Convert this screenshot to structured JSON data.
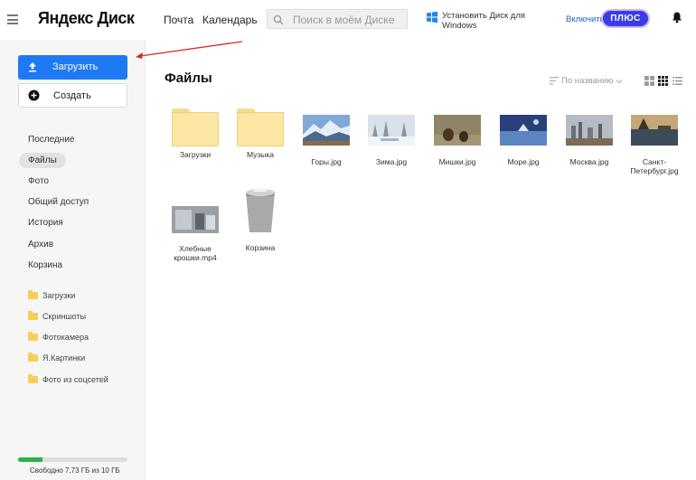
{
  "header": {
    "logo": "Яндекс Диск",
    "nav_mail": "Почта",
    "nav_calendar": "Календарь",
    "search_placeholder": "Поиск в моём Диске",
    "install_text": "Установить Диск для Windows",
    "plus_prefix": "Включить",
    "plus_label": "ПЛЮС"
  },
  "sidebar": {
    "upload_label": "Загрузить",
    "create_label": "Создать",
    "nav": [
      {
        "label": "Последние",
        "active": false
      },
      {
        "label": "Файлы",
        "active": true
      },
      {
        "label": "Фото",
        "active": false
      },
      {
        "label": "Общий доступ",
        "active": false
      },
      {
        "label": "История",
        "active": false
      },
      {
        "label": "Архив",
        "active": false
      },
      {
        "label": "Корзина",
        "active": false
      }
    ],
    "folders": [
      {
        "label": "Загрузки"
      },
      {
        "label": "Скриншоты"
      },
      {
        "label": "Фотокамера"
      },
      {
        "label": "Я.Картинки"
      },
      {
        "label": "Фото из соцсетей"
      }
    ],
    "storage": {
      "text": "Свободно 7,73 ГБ из 10 ГБ",
      "used_fraction": 0.227
    }
  },
  "main": {
    "title": "Файлы",
    "sort_label": "По названию",
    "files": [
      {
        "name": "Загрузки",
        "kind": "folder"
      },
      {
        "name": "Музыка",
        "kind": "folder"
      },
      {
        "name": "Горы.jpg",
        "kind": "image",
        "thumb": "mountains"
      },
      {
        "name": "Зима.jpg",
        "kind": "image",
        "thumb": "winter"
      },
      {
        "name": "Мишки.jpg",
        "kind": "image",
        "thumb": "bears"
      },
      {
        "name": "Море.jpg",
        "kind": "image",
        "thumb": "sea"
      },
      {
        "name": "Москва.jpg",
        "kind": "image",
        "thumb": "moscow"
      },
      {
        "name": "Санкт-Петербург.jpg",
        "kind": "image",
        "thumb": "spb"
      },
      {
        "name": "Хлебные крошки.mp4",
        "kind": "video",
        "thumb": "video"
      },
      {
        "name": "Корзина",
        "kind": "trash"
      }
    ]
  },
  "colors": {
    "accent_blue": "#1f79f2",
    "plus_purple": "#3b3ce6",
    "folder_yellow": "#fbe7a3",
    "storage_green": "#2bb24c",
    "annotation_arrow": "#d62a2a"
  }
}
